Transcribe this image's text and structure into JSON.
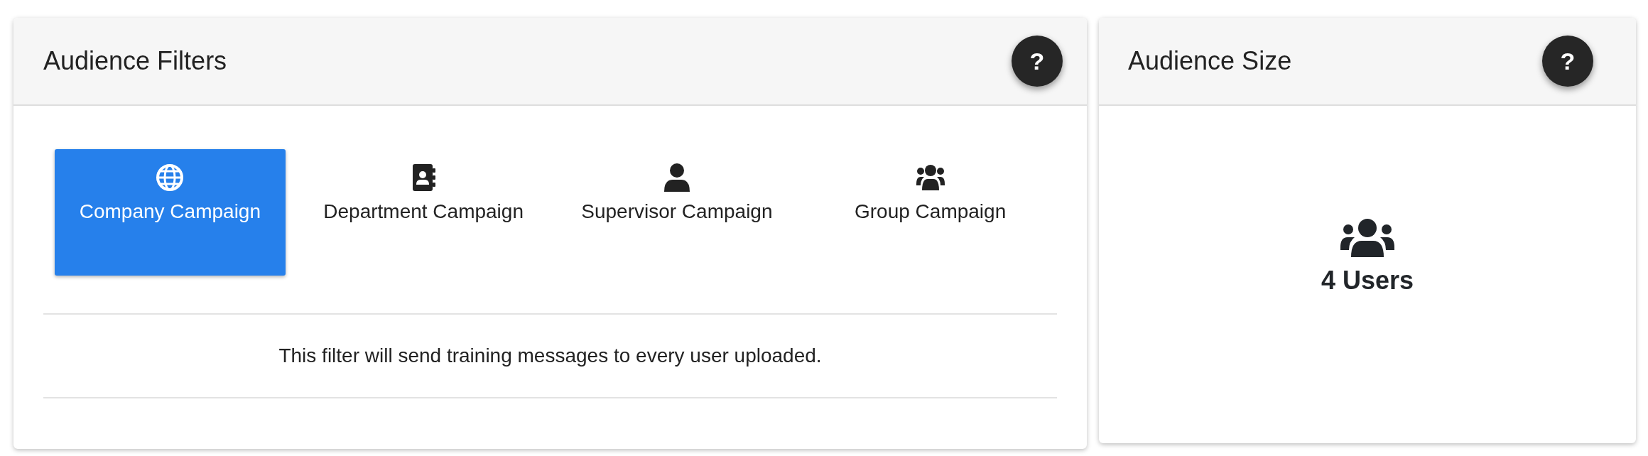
{
  "filters_card": {
    "title": "Audience Filters",
    "help": "?",
    "filters": [
      {
        "label": "Company Campaign",
        "selected": true
      },
      {
        "label": "Department Campaign",
        "selected": false
      },
      {
        "label": "Supervisor Campaign",
        "selected": false
      },
      {
        "label": "Group Campaign",
        "selected": false
      }
    ],
    "description": "This filter will send training messages to every user uploaded."
  },
  "size_card": {
    "title": "Audience Size",
    "help": "?",
    "count": "4 Users"
  }
}
